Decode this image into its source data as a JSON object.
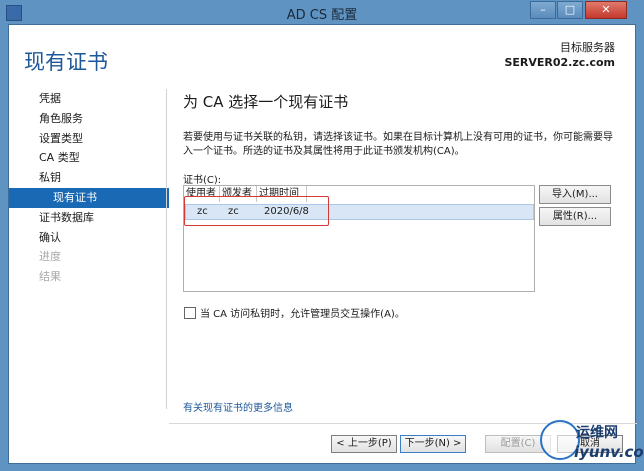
{
  "window": {
    "title": "AD CS 配置"
  },
  "header": {
    "page_title": "现有证书",
    "target_label": "目标服务器",
    "target_value": "SERVER02.zc.com"
  },
  "nav": {
    "items": [
      {
        "label": "凭据",
        "state": "normal"
      },
      {
        "label": "角色服务",
        "state": "normal"
      },
      {
        "label": "设置类型",
        "state": "normal"
      },
      {
        "label": "CA 类型",
        "state": "normal"
      },
      {
        "label": "私钥",
        "state": "normal"
      },
      {
        "label": "现有证书",
        "state": "active"
      },
      {
        "label": "证书数据库",
        "state": "normal"
      },
      {
        "label": "确认",
        "state": "normal"
      },
      {
        "label": "进度",
        "state": "disabled"
      },
      {
        "label": "结果",
        "state": "disabled"
      }
    ]
  },
  "main": {
    "section_title": "为 CA 选择一个现有证书",
    "description": "若要使用与证书关联的私钥，请选择该证书。如果在目标计算机上没有可用的证书，你可能需要导入一个证书。所选的证书及其属性将用于此证书颁发机构(CA)。",
    "cert_label": "证书(C):",
    "columns": [
      "使用者",
      "颁发者",
      "过期时间"
    ],
    "rows": [
      {
        "subject": "zc",
        "issuer": "zc",
        "expiry": "2020/6/8"
      }
    ],
    "import_button": "导入(M)...",
    "properties_button": "属性(R)...",
    "checkbox_label": "当 CA 访问私钥时，允许管理员交互操作(A)。",
    "more_link": "有关现有证书的更多信息"
  },
  "footer": {
    "prev": "< 上一步(P)",
    "next": "下一步(N) >",
    "configure": "配置(C)",
    "cancel": "取消"
  },
  "watermark": {
    "top": "运维网",
    "url": "iyunv.com"
  },
  "colors": {
    "accent": "#1a69b5",
    "link": "#1e5799",
    "highlight_box": "#d33a36"
  }
}
